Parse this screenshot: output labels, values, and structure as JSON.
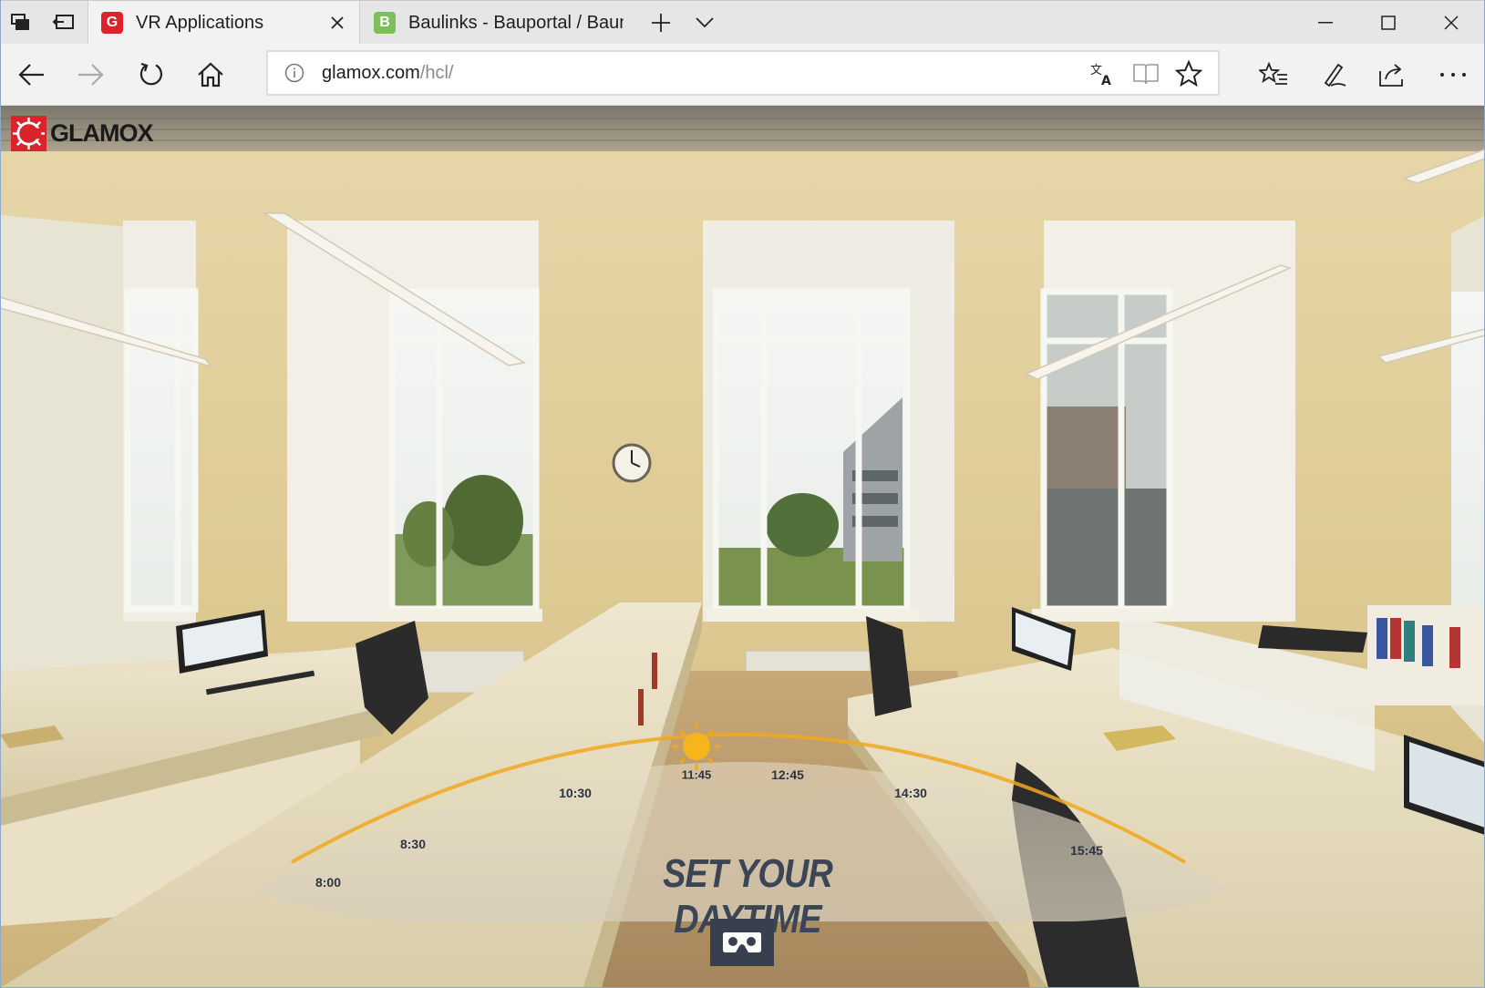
{
  "browser": {
    "tabs": [
      {
        "title": "VR Applications",
        "favicon_letter": "G",
        "favicon_color": "#d9232d",
        "active": true
      },
      {
        "title": "Baulinks - Bauportal / Baum",
        "favicon_letter": "B",
        "favicon_color": "#7dbf5a",
        "active": false
      }
    ],
    "address": {
      "domain": "glamox.com",
      "path": "/hcl/"
    }
  },
  "page": {
    "logo_text": "GLAMOX",
    "brand_color": "#d9232d",
    "headline": "SET YOUR DAYTIME",
    "time_slider": {
      "labels": [
        "8:00",
        "8:30",
        "10:30",
        "11:45",
        "12:45",
        "14:30",
        "15:45"
      ],
      "selected": "11:45",
      "accent_color": "#f0a820"
    },
    "vr_button_icon": "vr-headset-icon"
  }
}
